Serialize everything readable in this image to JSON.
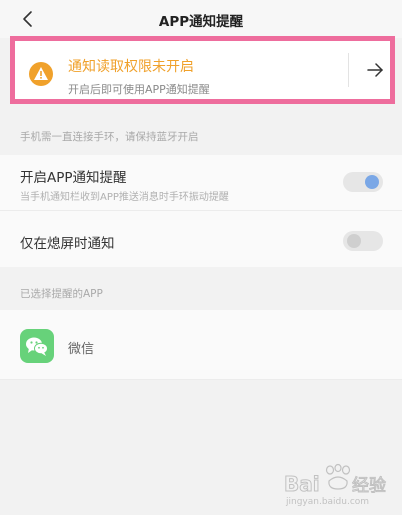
{
  "header": {
    "back_icon": "chevron-left-icon",
    "title": "APP通知提醒"
  },
  "permission_banner": {
    "icon": "warning-icon",
    "title": "通知读取权限未开启",
    "subtitle": "开启后即可使用APP通知提醒",
    "arrow_icon": "arrow-right-icon",
    "title_color": "#f0a12b",
    "highlight_border_color": "#ee6d9d"
  },
  "bluetooth_hint": "手机需一直连接手环，请保持蓝牙开启",
  "settings": [
    {
      "title": "开启APP通知提醒",
      "subtitle": "当手机通知栏收到APP推送消息时手环振动提醒",
      "toggle_on": true
    },
    {
      "title": "仅在熄屏时通知",
      "toggle_on": false
    }
  ],
  "selected_apps_label": "已选择提醒的APP",
  "apps": [
    {
      "name": "微信",
      "icon": "wechat-icon",
      "color": "#67d27a"
    }
  ],
  "watermark": {
    "text": "Bai 经验",
    "subtext": "jingyan.baidu.com"
  }
}
